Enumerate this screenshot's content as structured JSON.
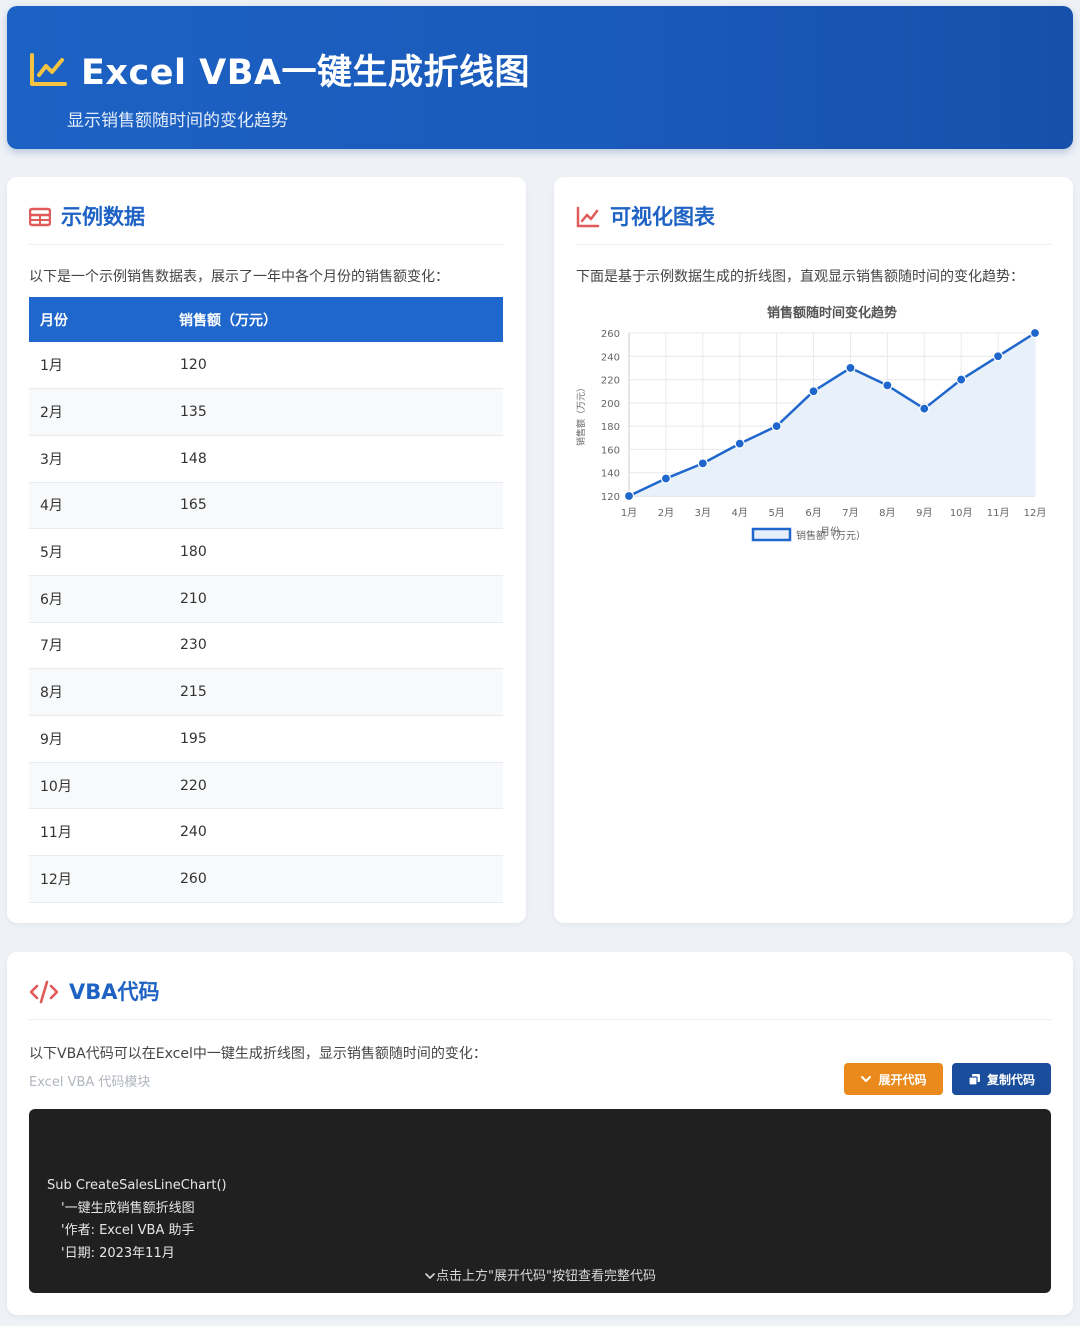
{
  "header": {
    "title": "Excel VBA一键生成折线图",
    "subtitle": "显示销售额随时间的变化趋势"
  },
  "data_section": {
    "title": "示例数据",
    "description": "以下是一个示例销售数据表，展示了一年中各个月份的销售额变化：",
    "columns": [
      "月份",
      "销售额（万元）"
    ],
    "rows": [
      [
        "1月",
        "120"
      ],
      [
        "2月",
        "135"
      ],
      [
        "3月",
        "148"
      ],
      [
        "4月",
        "165"
      ],
      [
        "5月",
        "180"
      ],
      [
        "6月",
        "210"
      ],
      [
        "7月",
        "230"
      ],
      [
        "8月",
        "215"
      ],
      [
        "9月",
        "195"
      ],
      [
        "10月",
        "220"
      ],
      [
        "11月",
        "240"
      ],
      [
        "12月",
        "260"
      ]
    ]
  },
  "chart_section": {
    "title": "可视化图表",
    "description": "下面是基于示例数据生成的折线图，直观显示销售额随时间的变化趋势："
  },
  "chart_data": {
    "type": "line",
    "title": "销售额随时间变化趋势",
    "xlabel": "月份",
    "ylabel": "销售额（万元）",
    "categories": [
      "1月",
      "2月",
      "3月",
      "4月",
      "5月",
      "6月",
      "7月",
      "8月",
      "9月",
      "10月",
      "11月",
      "12月"
    ],
    "series": [
      {
        "name": "销售额（万元）",
        "values": [
          120,
          135,
          148,
          165,
          180,
          210,
          230,
          215,
          195,
          220,
          240,
          260
        ]
      }
    ],
    "ylim": [
      120,
      260
    ],
    "yticks": [
      "120",
      "140",
      "160",
      "180",
      "200",
      "220",
      "240",
      "260"
    ],
    "grid": true,
    "legend": "bottom",
    "line_color": "#1f67cc",
    "fill_color": "#e6eef9"
  },
  "code_section": {
    "title": "VBA代码",
    "description": "以下VBA代码可以在Excel中一键生成折线图，显示销售额随时间的变化：",
    "module_label": "Excel VBA 代码模块",
    "expand_label": "展开代码",
    "copy_label": "复制代码",
    "code_lines": [
      "Sub CreateSalesLineChart()",
      "'一键生成销售额折线图",
      "'作者: Excel VBA 助手",
      "'日期: 2023年11月"
    ],
    "hint": "点击上方\"展开代码\"按钮查看完整代码"
  },
  "colors": {
    "header_bg": "#1c62c4",
    "accent": "#1e63c4",
    "icon_red": "#e05a5a",
    "expand_btn": "#ea8a1c",
    "copy_btn": "#1a4d9c",
    "code_bg": "#202020"
  }
}
